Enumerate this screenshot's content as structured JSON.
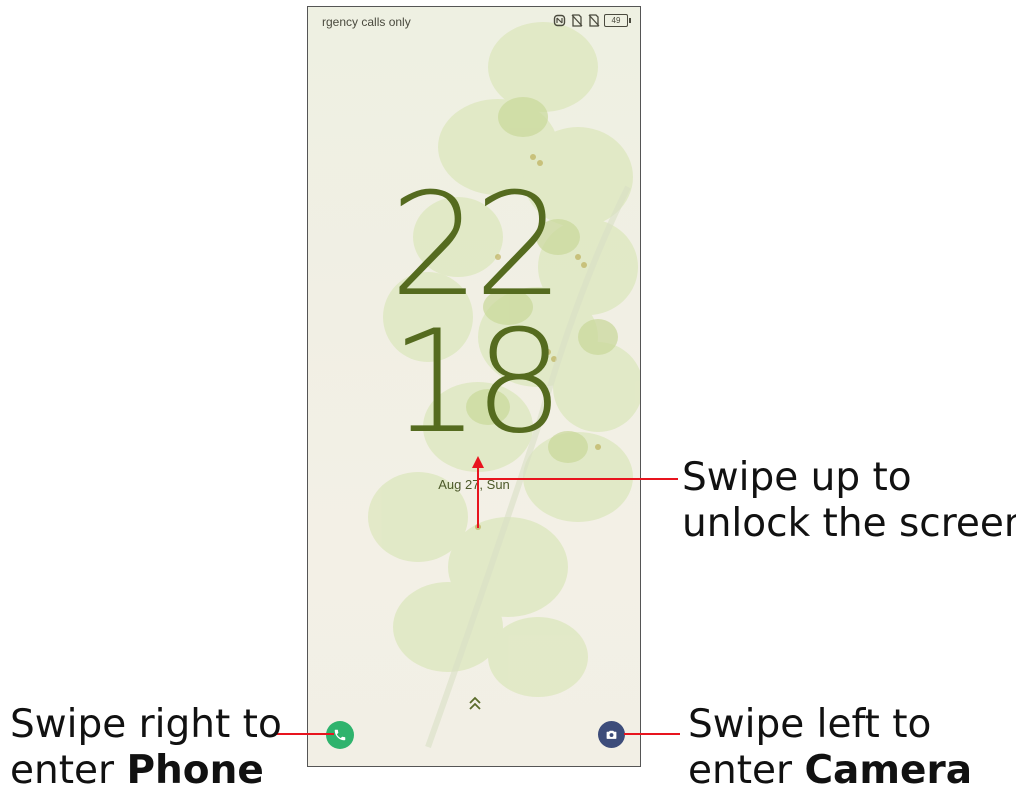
{
  "status_bar": {
    "carrier_text": "rgency calls only",
    "battery_level": "49",
    "icons": [
      "nfc-icon",
      "no-sim-icon",
      "no-sim-icon",
      "battery-icon"
    ]
  },
  "lock_screen": {
    "clock_hours": "22",
    "clock_minutes": "18",
    "date": "Aug 27, Sun",
    "swipe_hint_icon": "double-chevron-up-icon",
    "left_shortcut_icon": "phone-icon",
    "right_shortcut_icon": "camera-icon"
  },
  "annotations": {
    "unlock_line1": "Swipe up to",
    "unlock_line2": "unlock the screen",
    "phone_line1": "Swipe right to",
    "phone_line2_prefix": "enter ",
    "phone_line2_bold": "Phone",
    "camera_line1": "Swipe left to",
    "camera_line2_prefix": "enter ",
    "camera_line2_bold": "Camera"
  },
  "colors": {
    "clock": "#556b1f",
    "phone_button": "#2fb36d",
    "camera_button": "#3d4c7a",
    "annotation_line": "#e8141e"
  }
}
